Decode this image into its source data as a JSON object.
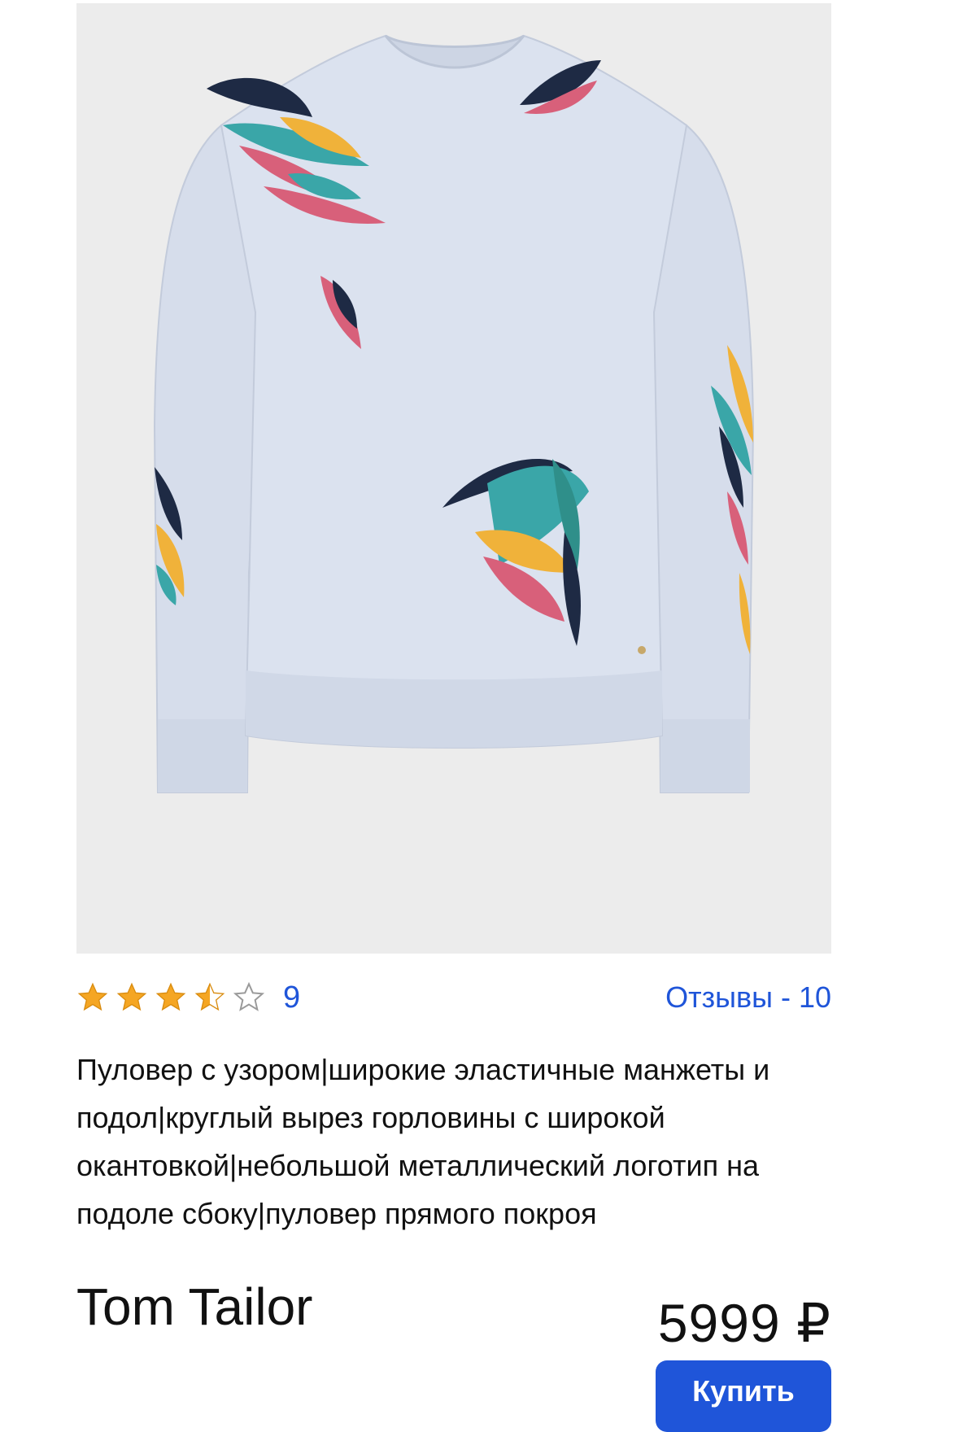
{
  "product": {
    "image_alt": "Пуловер с узором",
    "rating": {
      "value": 3.5,
      "max": 5,
      "count": "9"
    },
    "reviews_link": "Отзывы - 10",
    "description": "Пуловер с узором|широкие эластичные манжеты и подол|круглый вырез горловины с широкой окантовкой|небольшой металлический логотип на подоле сбоку|пуловер прямого покроя",
    "brand": "Tom Tailor",
    "price": "5999 ₽",
    "buy_label": "Купить"
  },
  "colors": {
    "accent": "#1f55d9",
    "star_fill": "#f5a623",
    "star_empty": "#9a9a9a",
    "image_background": "#ececec",
    "sweater": "#dbe2ef"
  }
}
